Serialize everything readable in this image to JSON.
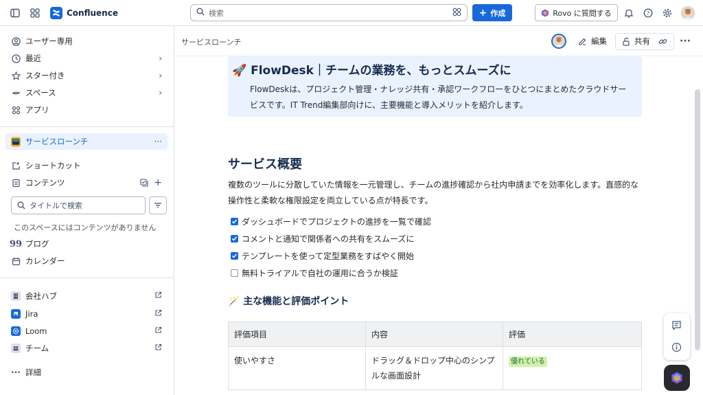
{
  "topbar": {
    "app_name": "Confluence",
    "search_placeholder": "検索",
    "create_label": "作成",
    "rovo_label": "Rovo に質問する"
  },
  "sidebar": {
    "nav": [
      {
        "label": "ユーザー専用",
        "icon": "user-circle-icon"
      },
      {
        "label": "最近",
        "icon": "clock-icon"
      },
      {
        "label": "スター付き",
        "icon": "star-icon"
      },
      {
        "label": "スペース",
        "icon": "spaces-icon"
      },
      {
        "label": "アプリ",
        "icon": "apps-icon"
      }
    ],
    "space_name": "サービスローンチ",
    "space_more": "···",
    "shortcuts_label": "ショートカット",
    "content_label": "コンテンツ",
    "filter_placeholder": "タイトルで検索",
    "empty_note": "このスペースにはコンテンツがありません",
    "blog_label": "ブログ",
    "calendar_label": "カレンダー",
    "apps": [
      {
        "label": "会社ハブ",
        "icon": "building-icon"
      },
      {
        "label": "Jira",
        "icon": "jira-icon"
      },
      {
        "label": "Loom",
        "icon": "loom-icon"
      },
      {
        "label": "チーム",
        "icon": "team-icon"
      }
    ],
    "more_label": "詳細"
  },
  "header": {
    "page_title": "サービスローンチ",
    "edit_label": "編集",
    "share_label": "共有"
  },
  "content": {
    "panel_title": "🚀 FlowDesk｜チームの業務を、もっとスムーズに",
    "panel_text": "FlowDeskは、プロジェクト管理・ナレッジ共有・承認ワークフローをひとつにまとめたクラウドサービスです。IT Trend編集部向けに、主要機能と導入メリットを紹介します。",
    "overview_heading": "サービス概要",
    "overview_text": "複数のツールに分散していた情報を一元管理し、チームの進捗確認から社内申請までを効率化します。直感的な操作性と柔軟な権限設定を両立している点が特長です。",
    "tasks": [
      {
        "text": "ダッシュボードでプロジェクトの進捗を一覧で確認",
        "checked": true
      },
      {
        "text": "コメントと通知で関係者への共有をスムーズに",
        "checked": true
      },
      {
        "text": "テンプレートを使って定型業務をすばやく開始",
        "checked": true
      },
      {
        "text": "無料トライアルで自社の運用に合うか検証",
        "checked": false
      }
    ],
    "features_heading": "🪄 主な機能と評価ポイント",
    "table": {
      "headers": [
        "評価項目",
        "内容",
        "評価"
      ],
      "rows": [
        {
          "item": "使いやすさ",
          "detail": "ドラッグ＆ドロップ中心のシンプルな画面設計",
          "rating": "優れている"
        }
      ]
    }
  },
  "colors": {
    "accent": "#1868db",
    "panel_bg": "#e9f2fe",
    "lozenge_bg": "#d3f1a7",
    "lozenge_text": "#216e4e"
  }
}
